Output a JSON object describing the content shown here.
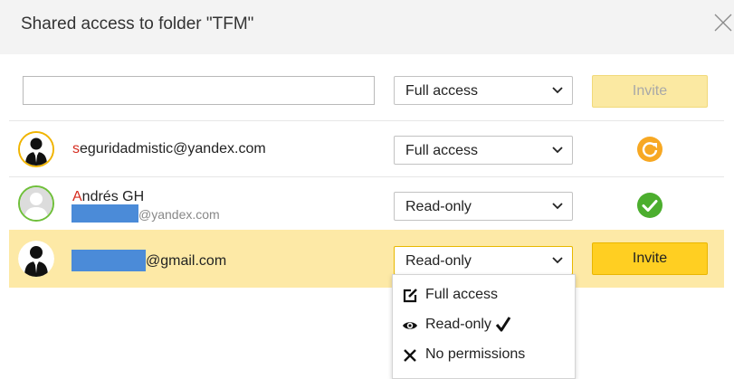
{
  "dialog": {
    "title": "Shared access to folder \"TFM\""
  },
  "invite_bar": {
    "email_value": "",
    "access_select": "Full access",
    "invite_label": "Invite",
    "invite_enabled": false
  },
  "users": [
    {
      "email_first_letter": "s",
      "email_rest": "seguridadmistic@yandex.com",
      "access": "Full access",
      "status": "pending-refresh-icon",
      "avatar": "user-avatar-icon"
    },
    {
      "name_first_letter": "A",
      "name_rest": "Andrés GH",
      "email_domain": "@yandex.com",
      "access": "Read-only",
      "status": "accepted-check-icon",
      "avatar": "placeholder-avatar-icon"
    },
    {
      "email_domain": "@gmail.com",
      "access": "Read-only",
      "invite_label": "Invite",
      "avatar": "user-avatar-icon"
    }
  ],
  "access_menu": {
    "items": [
      {
        "label": "Full access",
        "icon": "edit-icon",
        "selected": false
      },
      {
        "label": "Read-only",
        "icon": "eye-icon",
        "selected": true
      },
      {
        "label": "No permissions",
        "icon": "x-icon",
        "selected": false
      }
    ]
  },
  "colors": {
    "accent_yellow": "#ffcf22",
    "highlight_row": "#fde9a6",
    "status_orange": "#f7a823",
    "status_green": "#4cae2e",
    "brand_red": "#d52b1e"
  }
}
